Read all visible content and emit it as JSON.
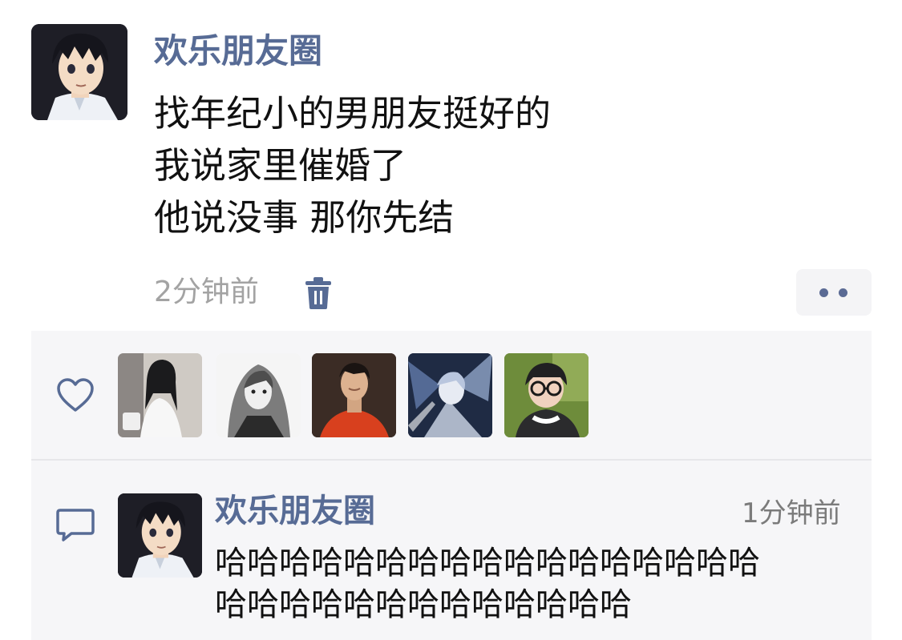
{
  "post": {
    "author": "欢乐朋友圈",
    "avatar_icon": "anime-boy-avatar",
    "lines": [
      "找年纪小的男朋友挺好的",
      "我说家里催婚了",
      "他说没事 那你先结"
    ],
    "time": "2分钟前",
    "delete_icon": "trash-icon",
    "more_icon": "more-dots-icon"
  },
  "likes": {
    "icon": "heart-outline-icon",
    "avatars": [
      {
        "icon": "avatar-girl-white-dress"
      },
      {
        "icon": "avatar-sketch-girl"
      },
      {
        "icon": "avatar-boy-red-shirt"
      },
      {
        "icon": "avatar-anime-blue-art"
      },
      {
        "icon": "avatar-child-glasses"
      }
    ]
  },
  "comment": {
    "icon": "comment-bubble-icon",
    "author": "欢乐朋友圈",
    "time": "1分钟前",
    "lines": [
      "哈哈哈哈哈哈哈哈哈哈哈哈哈哈哈哈哈",
      "哈哈哈哈哈哈哈哈哈哈哈哈哈"
    ]
  },
  "colors": {
    "name_link": "#576b95",
    "text": "#111111",
    "meta": "#a3a3a3",
    "panel_bg": "#f6f6f8"
  }
}
